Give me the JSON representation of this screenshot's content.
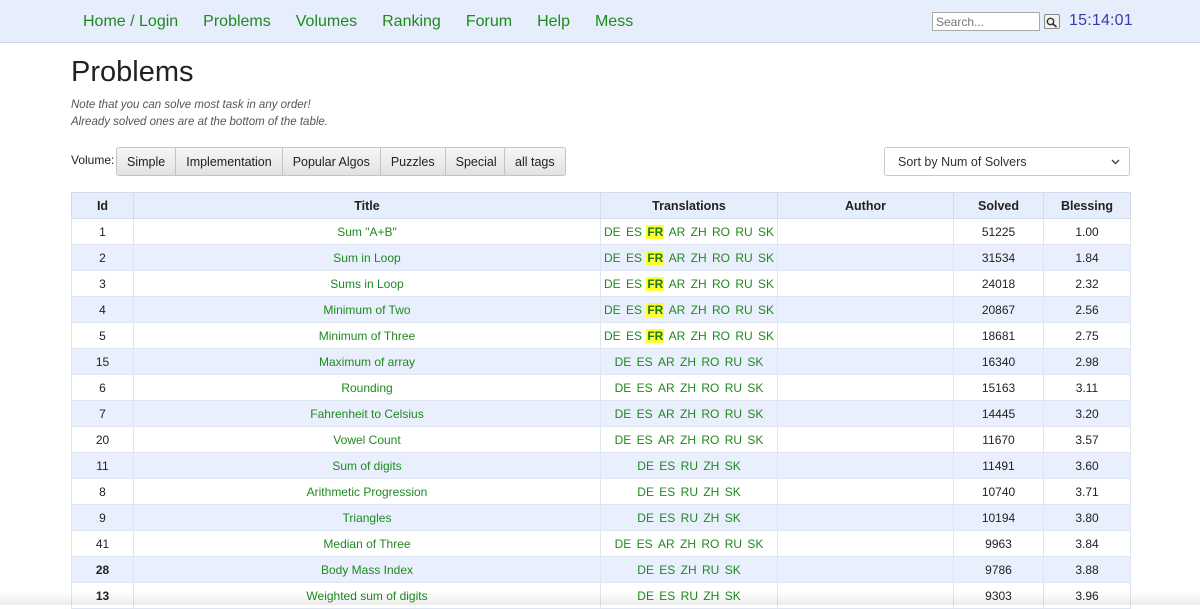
{
  "nav": {
    "links": [
      "Home / Login",
      "Problems",
      "Volumes",
      "Ranking",
      "Forum",
      "Help",
      "Mess"
    ],
    "search_placeholder": "Search...",
    "clock": "15:14:01"
  },
  "page": {
    "title": "Problems",
    "note1": "Note that you can solve most task in any order!",
    "note2": "Already solved ones are at the bottom of the table."
  },
  "filters": {
    "volume_label": "Volume:",
    "volumes": [
      "Simple",
      "Implementation",
      "Popular Algos",
      "Puzzles",
      "Special"
    ],
    "tags_button": "all tags",
    "sort_selected": "Sort by Num of Solvers"
  },
  "table": {
    "headers": [
      "Id",
      "Title",
      "Translations",
      "Author",
      "Solved",
      "Blessing"
    ],
    "rows": [
      {
        "id": "1",
        "title": "Sum \"A+B\"",
        "translations": [
          "DE",
          "ES",
          "FR",
          "AR",
          "ZH",
          "RO",
          "RU",
          "SK"
        ],
        "highlight": "FR",
        "author": "",
        "solved": "51225",
        "blessing": "1.00",
        "bold_id": false
      },
      {
        "id": "2",
        "title": "Sum in Loop",
        "translations": [
          "DE",
          "ES",
          "FR",
          "AR",
          "ZH",
          "RO",
          "RU",
          "SK"
        ],
        "highlight": "FR",
        "author": "",
        "solved": "31534",
        "blessing": "1.84",
        "bold_id": false
      },
      {
        "id": "3",
        "title": "Sums in Loop",
        "translations": [
          "DE",
          "ES",
          "FR",
          "AR",
          "ZH",
          "RO",
          "RU",
          "SK"
        ],
        "highlight": "FR",
        "author": "",
        "solved": "24018",
        "blessing": "2.32",
        "bold_id": false
      },
      {
        "id": "4",
        "title": "Minimum of Two",
        "translations": [
          "DE",
          "ES",
          "FR",
          "AR",
          "ZH",
          "RO",
          "RU",
          "SK"
        ],
        "highlight": "FR",
        "author": "",
        "solved": "20867",
        "blessing": "2.56",
        "bold_id": false
      },
      {
        "id": "5",
        "title": "Minimum of Three",
        "translations": [
          "DE",
          "ES",
          "FR",
          "AR",
          "ZH",
          "RO",
          "RU",
          "SK"
        ],
        "highlight": "FR",
        "author": "",
        "solved": "18681",
        "blessing": "2.75",
        "bold_id": false
      },
      {
        "id": "15",
        "title": "Maximum of array",
        "translations": [
          "DE",
          "ES",
          "AR",
          "ZH",
          "RO",
          "RU",
          "SK"
        ],
        "highlight": "",
        "author": "",
        "solved": "16340",
        "blessing": "2.98",
        "bold_id": false
      },
      {
        "id": "6",
        "title": "Rounding",
        "translations": [
          "DE",
          "ES",
          "AR",
          "ZH",
          "RO",
          "RU",
          "SK"
        ],
        "highlight": "",
        "author": "",
        "solved": "15163",
        "blessing": "3.11",
        "bold_id": false
      },
      {
        "id": "7",
        "title": "Fahrenheit to Celsius",
        "translations": [
          "DE",
          "ES",
          "AR",
          "ZH",
          "RO",
          "RU",
          "SK"
        ],
        "highlight": "",
        "author": "",
        "solved": "14445",
        "blessing": "3.20",
        "bold_id": false
      },
      {
        "id": "20",
        "title": "Vowel Count",
        "translations": [
          "DE",
          "ES",
          "AR",
          "ZH",
          "RO",
          "RU",
          "SK"
        ],
        "highlight": "",
        "author": "",
        "solved": "11670",
        "blessing": "3.57",
        "bold_id": false
      },
      {
        "id": "11",
        "title": "Sum of digits",
        "translations": [
          "DE",
          "ES",
          "RU",
          "ZH",
          "SK"
        ],
        "highlight": "",
        "author": "",
        "solved": "11491",
        "blessing": "3.60",
        "bold_id": false
      },
      {
        "id": "8",
        "title": "Arithmetic Progression",
        "translations": [
          "DE",
          "ES",
          "RU",
          "ZH",
          "SK"
        ],
        "highlight": "",
        "author": "",
        "solved": "10740",
        "blessing": "3.71",
        "bold_id": false
      },
      {
        "id": "9",
        "title": "Triangles",
        "translations": [
          "DE",
          "ES",
          "RU",
          "ZH",
          "SK"
        ],
        "highlight": "",
        "author": "",
        "solved": "10194",
        "blessing": "3.80",
        "bold_id": false
      },
      {
        "id": "41",
        "title": "Median of Three",
        "translations": [
          "DE",
          "ES",
          "AR",
          "ZH",
          "RO",
          "RU",
          "SK"
        ],
        "highlight": "",
        "author": "",
        "solved": "9963",
        "blessing": "3.84",
        "bold_id": false
      },
      {
        "id": "28",
        "title": "Body Mass Index",
        "translations": [
          "DE",
          "ES",
          "ZH",
          "RU",
          "SK"
        ],
        "highlight": "",
        "author": "",
        "solved": "9786",
        "blessing": "3.88",
        "bold_id": true
      },
      {
        "id": "13",
        "title": "Weighted sum of digits",
        "translations": [
          "DE",
          "ES",
          "RU",
          "ZH",
          "SK"
        ],
        "highlight": "",
        "author": "",
        "solved": "9303",
        "blessing": "3.96",
        "bold_id": true
      }
    ]
  },
  "colors": {
    "link_green": "#1e8a1e",
    "nav_bg": "#e6eefc",
    "clock_blue": "#3a3ab4",
    "highlight_yellow": "#ffff33"
  },
  "icons": {
    "search_button": "magnifier-icon",
    "sort_select": "chevron-down-icon"
  }
}
